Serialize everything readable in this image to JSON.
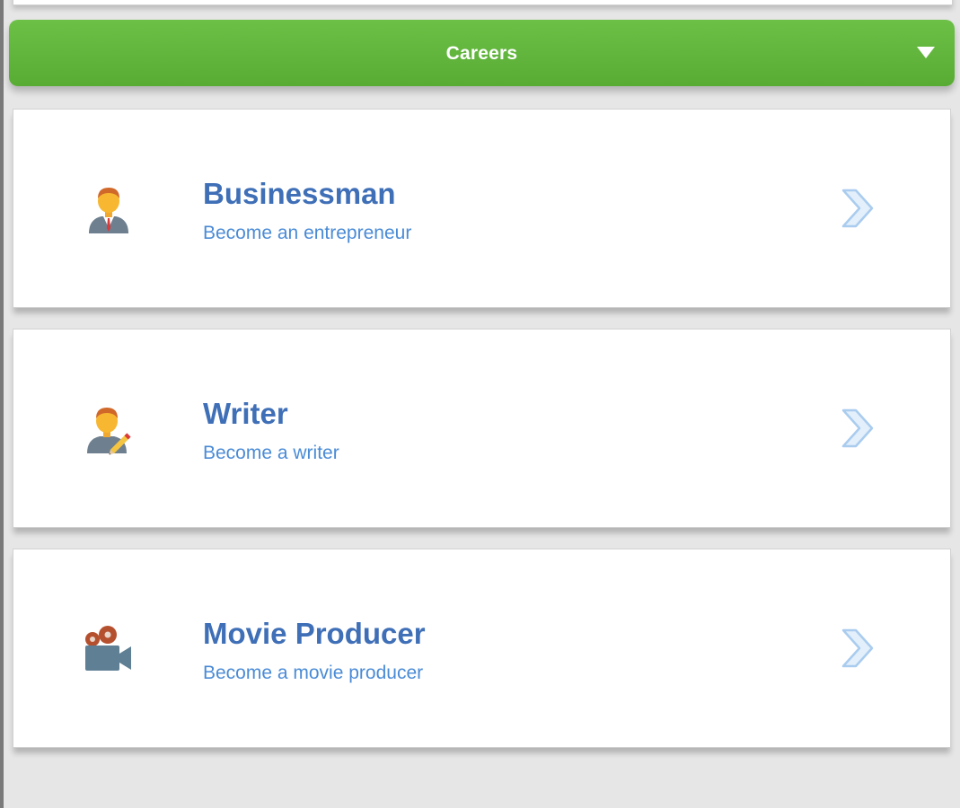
{
  "header": {
    "title": "Careers",
    "toggle_icon": "caret-down-icon"
  },
  "colors": {
    "accent_green": "#5fb53b",
    "title_blue": "#3f6fb7",
    "subtitle_blue": "#4a8bd6",
    "chevron_blue": "#a9ccef",
    "background": "#e6e6e6"
  },
  "careers": [
    {
      "title": "Businessman",
      "subtitle": "Become an entrepreneur",
      "icon": "businessman-icon"
    },
    {
      "title": "Writer",
      "subtitle": "Become a writer",
      "icon": "writer-icon"
    },
    {
      "title": "Movie Producer",
      "subtitle": "Become a movie producer",
      "icon": "movie-camera-icon"
    }
  ]
}
